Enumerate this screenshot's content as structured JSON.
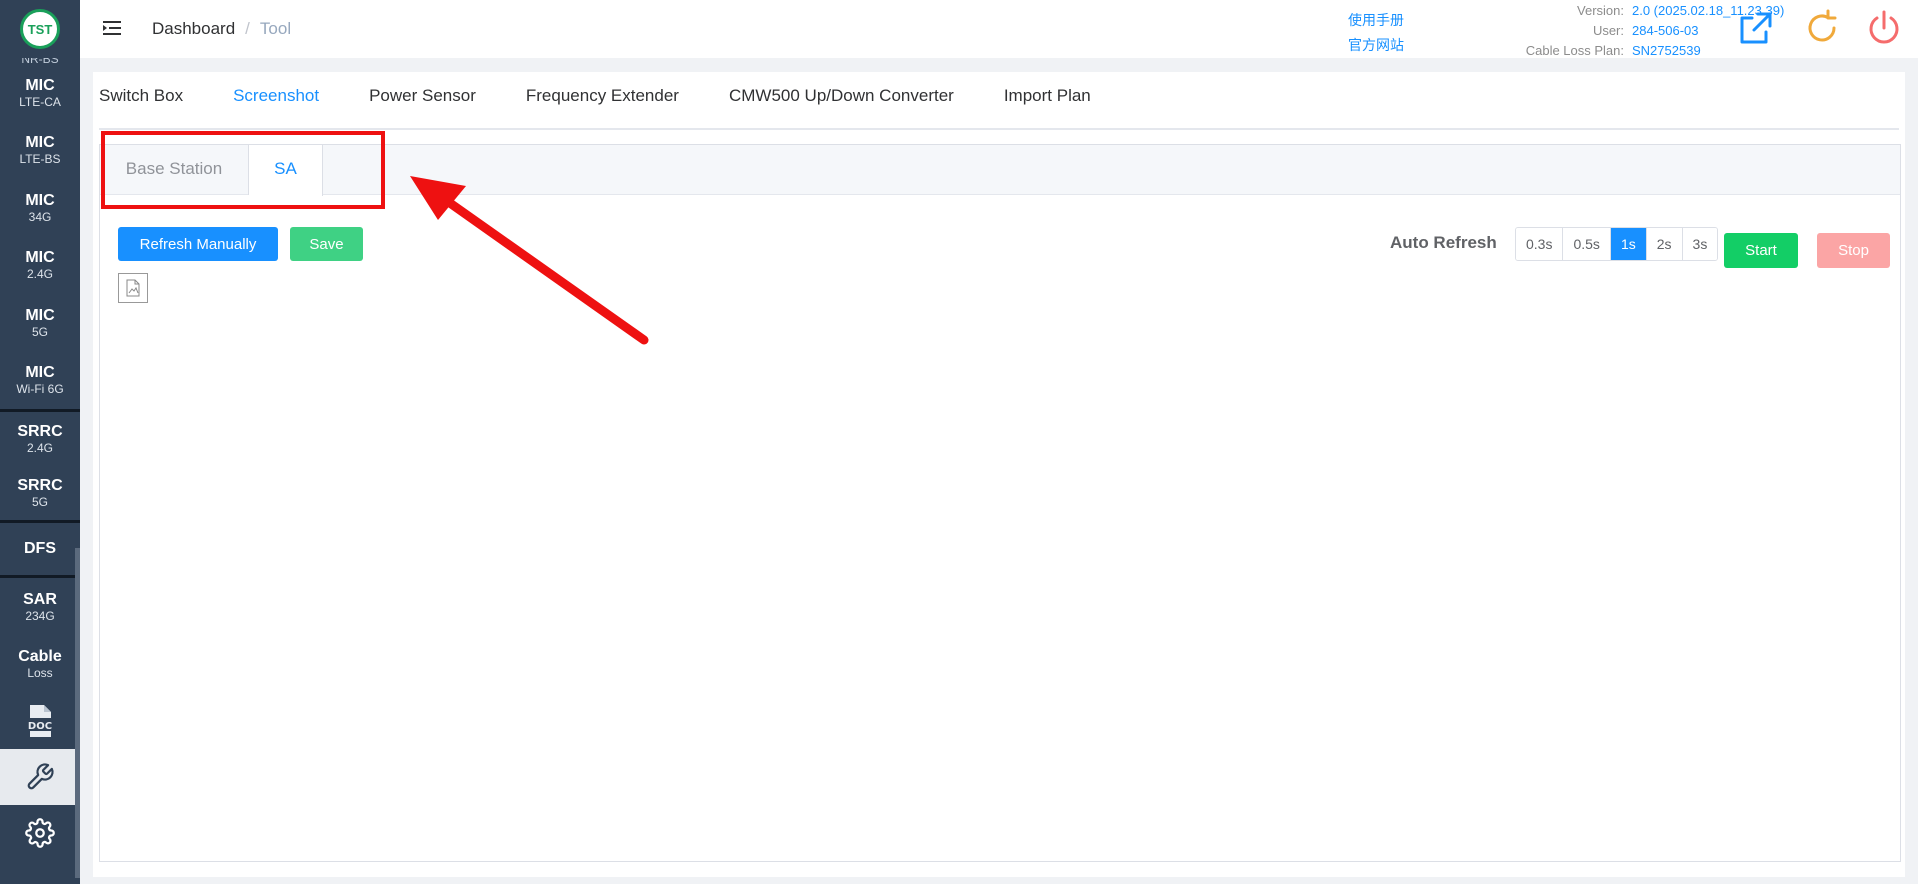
{
  "sidebar": {
    "logo_text": "TST",
    "cut_label": "NR-BS",
    "items": [
      {
        "main": "MIC",
        "sub": "LTE-CA"
      },
      {
        "main": "MIC",
        "sub": "LTE-BS"
      },
      {
        "main": "MIC",
        "sub": "34G"
      },
      {
        "main": "MIC",
        "sub": "2.4G"
      },
      {
        "main": "MIC",
        "sub": "5G"
      },
      {
        "main": "MIC",
        "sub": "Wi-Fi 6G"
      },
      {
        "main": "SRRC",
        "sub": "2.4G"
      },
      {
        "main": "SRRC",
        "sub": "5G"
      },
      {
        "main": "DFS",
        "sub": ""
      },
      {
        "main": "SAR",
        "sub": "234G"
      },
      {
        "main": "Cable",
        "sub": "Loss"
      }
    ],
    "doc_label": "DOC"
  },
  "header": {
    "breadcrumb": {
      "home": "Dashboard",
      "separator": "/",
      "current": "Tool"
    },
    "links": {
      "manual": "使用手册",
      "website": "官方网站"
    },
    "info": {
      "version_label": "Version:",
      "version_value": "2.0 (2025.02.18_11.23.39)",
      "user_label": "User:",
      "user_value": "284-506-03",
      "plan_label": "Cable Loss Plan:",
      "plan_value": "SN2752539"
    }
  },
  "tool_tabs": [
    {
      "label": "Switch Box",
      "active": false
    },
    {
      "label": "Screenshot",
      "active": true
    },
    {
      "label": "Power Sensor",
      "active": false
    },
    {
      "label": "Frequency Extender",
      "active": false
    },
    {
      "label": "CMW500 Up/Down Converter",
      "active": false
    },
    {
      "label": "Import Plan",
      "active": false
    }
  ],
  "screenshot": {
    "tabs": {
      "base_station": "Base Station",
      "sa": "SA"
    },
    "refresh_button": "Refresh Manually",
    "save_button": "Save",
    "auto_refresh_label": "Auto Refresh",
    "intervals": [
      "0.3s",
      "0.5s",
      "1s",
      "2s",
      "3s"
    ],
    "active_interval": "1s",
    "start_button": "Start",
    "stop_button": "Stop"
  },
  "colors": {
    "sidebar_bg": "#304156",
    "primary": "#1890ff",
    "success": "#13ce66",
    "save": "#3fd184",
    "stop_disabled": "#fba5a5",
    "annotation": "#ee1111"
  }
}
